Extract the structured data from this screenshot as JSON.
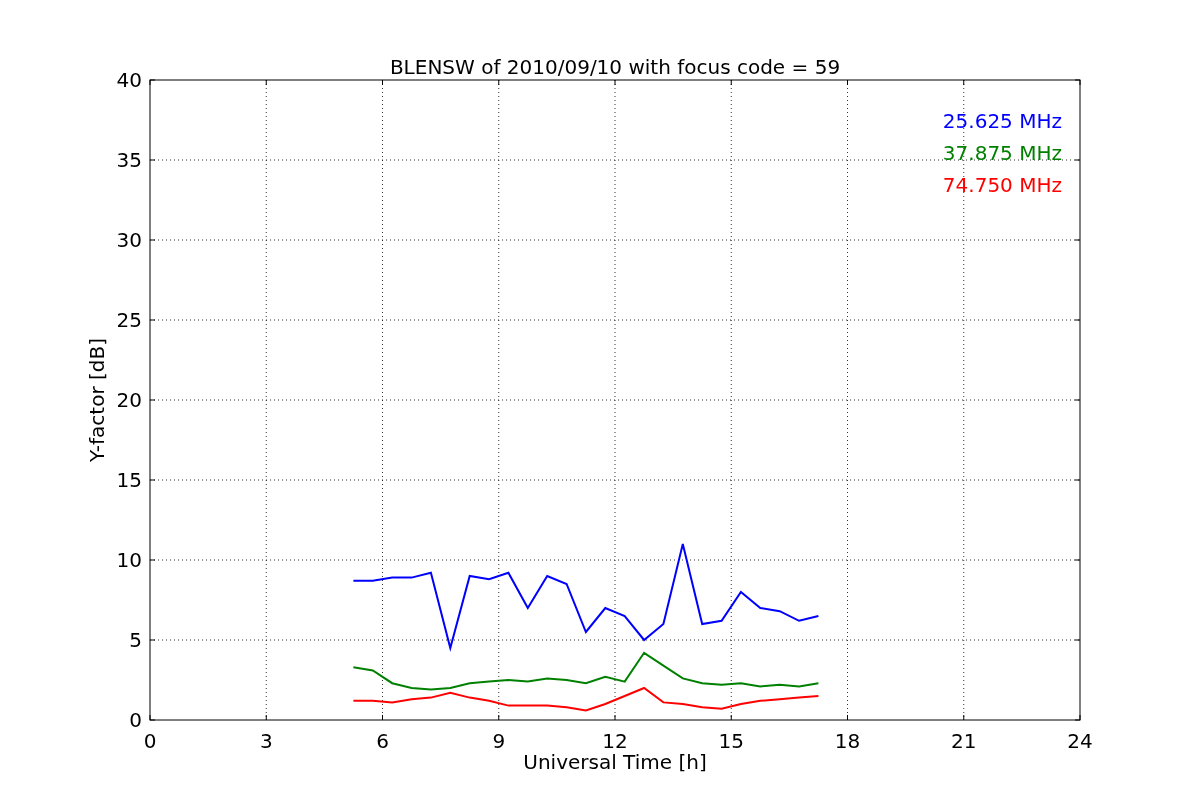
{
  "chart_data": {
    "type": "line",
    "title": "BLENSW of 2010/09/10 with focus code = 59",
    "xlabel": "Universal Time [h]",
    "ylabel": "Y-factor [dB]",
    "x": [
      5.25,
      5.75,
      6.25,
      6.75,
      7.25,
      7.75,
      8.25,
      8.75,
      9.25,
      9.75,
      10.25,
      10.75,
      11.25,
      11.75,
      12.25,
      12.75,
      13.25,
      13.75,
      14.25,
      14.75,
      15.25,
      15.75,
      16.25,
      16.75,
      17.25
    ],
    "series": [
      {
        "name": "25.625 MHz",
        "color": "#0000ff",
        "values": [
          8.7,
          8.7,
          8.9,
          8.9,
          9.2,
          4.5,
          9,
          8.8,
          9.2,
          7,
          9,
          8.5,
          5.5,
          7,
          6.5,
          5,
          6,
          11,
          6,
          6.2,
          8,
          7,
          6.8,
          6.2,
          6.5
        ]
      },
      {
        "name": "37.875 MHz",
        "color": "#008000",
        "values": [
          3.3,
          3.1,
          2.3,
          2,
          1.9,
          2,
          2.3,
          2.4,
          2.5,
          2.4,
          2.6,
          2.5,
          2.3,
          2.7,
          2.4,
          4.2,
          3.4,
          2.6,
          2.3,
          2.2,
          2.3,
          2.1,
          2.2,
          2.1,
          2.3
        ]
      },
      {
        "name": "74.750 MHz",
        "color": "#ff0000",
        "values": [
          1.2,
          1.2,
          1.1,
          1.3,
          1.4,
          1.7,
          1.4,
          1.2,
          0.9,
          0.9,
          0.9,
          0.8,
          0.6,
          1,
          1.5,
          2,
          1.1,
          1,
          0.8,
          0.7,
          1,
          1.2,
          1.3,
          1.4,
          1.5
        ]
      }
    ],
    "grid": true,
    "xlim": [
      0,
      24
    ],
    "ylim": [
      0,
      40
    ],
    "xticks": [
      0,
      3,
      6,
      9,
      12,
      15,
      18,
      21,
      24
    ],
    "yticks": [
      0,
      5,
      10,
      15,
      20,
      25,
      30,
      35,
      40
    ]
  }
}
